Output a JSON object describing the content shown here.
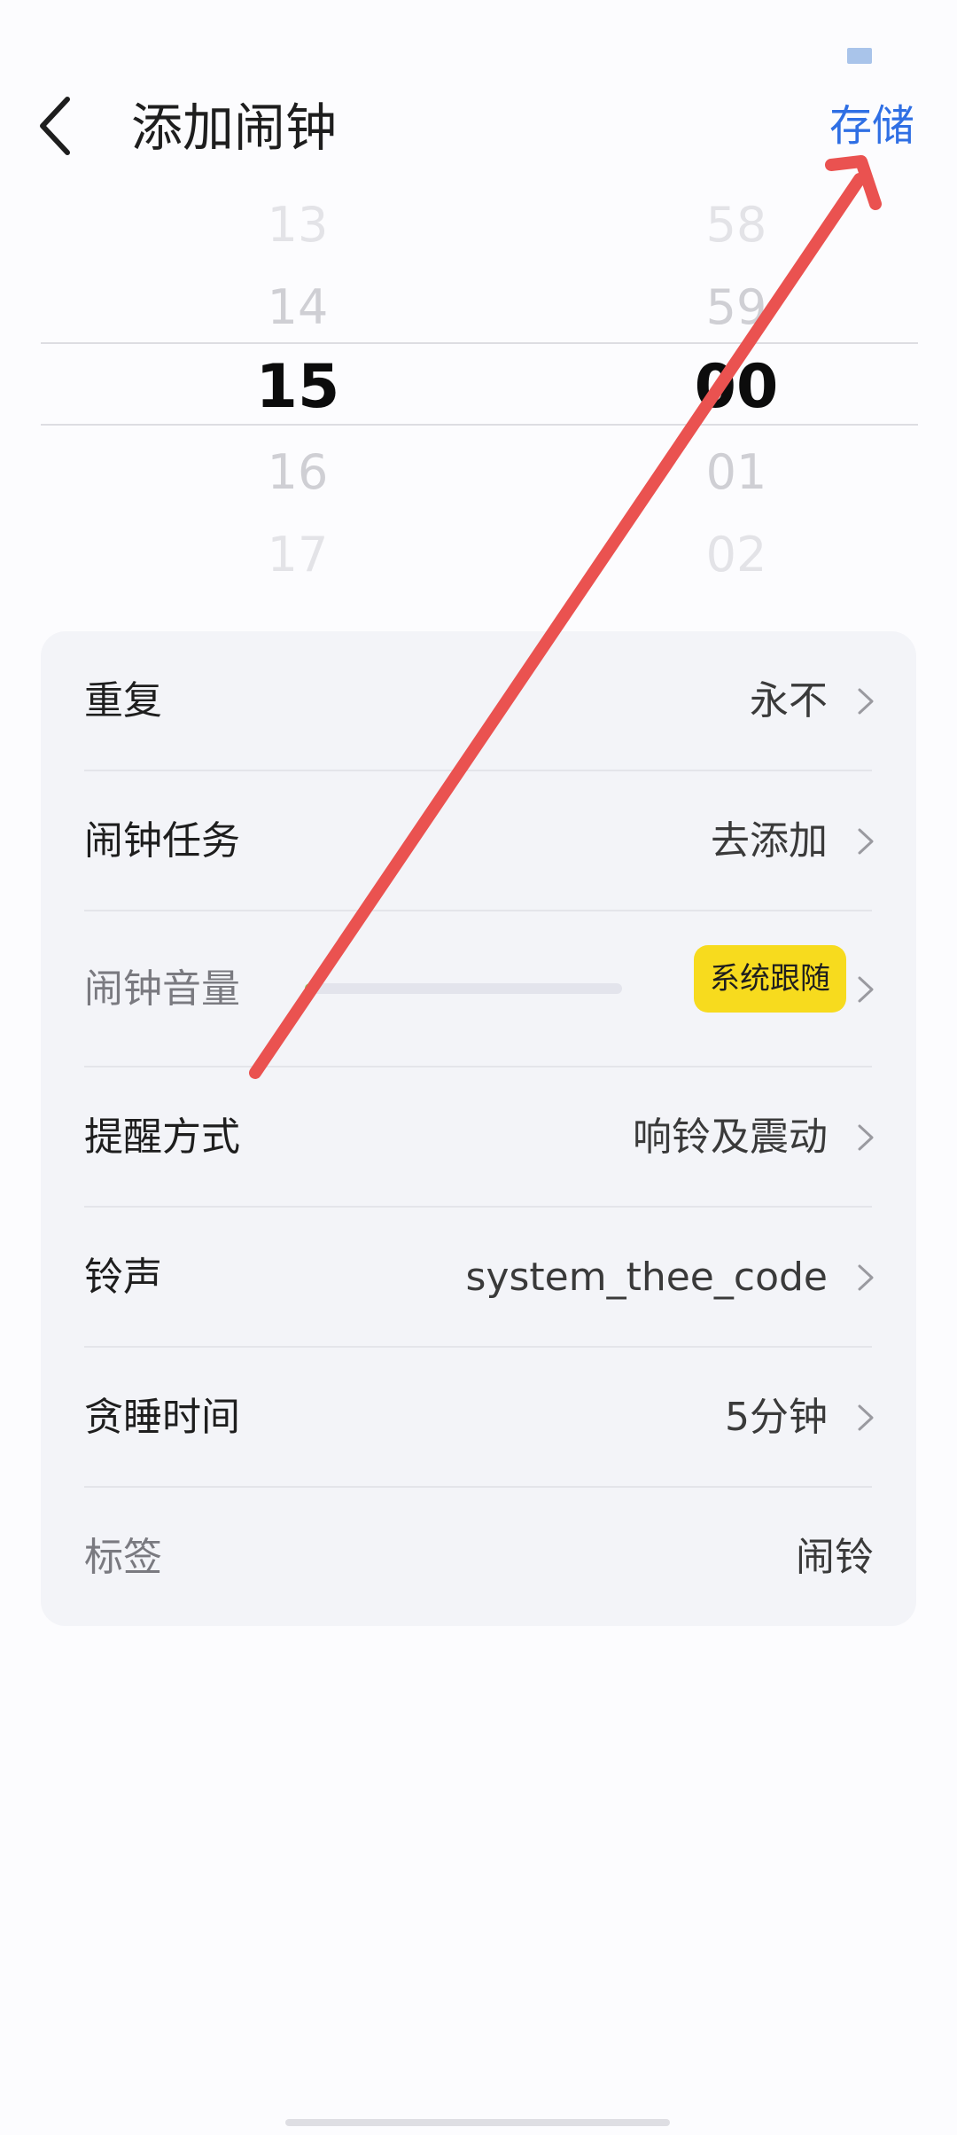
{
  "header": {
    "title": "添加闹钟",
    "save_label": "存储",
    "back_icon": "chevron-left-icon",
    "accent_color": "#2f6fe4"
  },
  "time_picker": {
    "hours": [
      "13",
      "14",
      "15",
      "16",
      "17"
    ],
    "minutes": [
      "58",
      "59",
      "00",
      "01",
      "02"
    ],
    "selected_hour": "15",
    "selected_minute": "00"
  },
  "settings": {
    "repeat": {
      "label": "重复",
      "value": "永不"
    },
    "task": {
      "label": "闹钟任务",
      "value": "去添加"
    },
    "volume": {
      "label": "闹钟音量",
      "level": 0.0,
      "badge": "系统跟随",
      "badge_color": "#f7db1e",
      "track_color": "#e3e4ec",
      "fill_color": "#7fd14a"
    },
    "reminder": {
      "label": "提醒方式",
      "value": "响铃及震动"
    },
    "ringtone": {
      "label": "铃声",
      "value": "system_thee_code"
    },
    "snooze": {
      "label": "贪睡时间",
      "value": "5分钟"
    },
    "tag": {
      "label": "标签",
      "value": "闹铃"
    }
  },
  "annotation": {
    "type": "arrow",
    "color": "#ea5250"
  }
}
